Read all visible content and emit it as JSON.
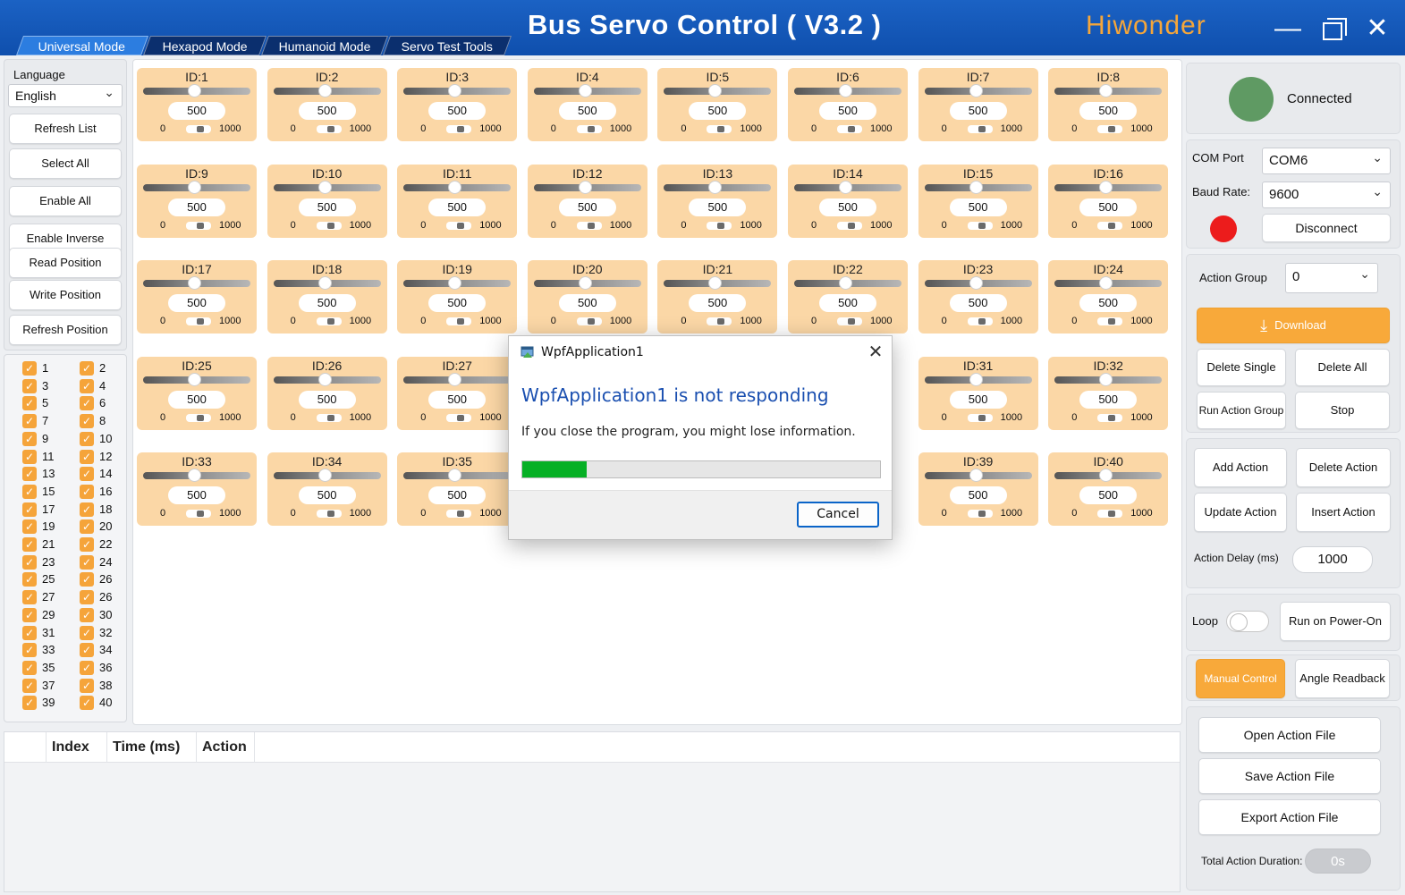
{
  "window": {
    "title": "Bus Servo Control ( V3.2 )",
    "brand": "Hiwonder",
    "minimize_glyph": "—",
    "close_glyph": "✕"
  },
  "tabs": [
    {
      "label": "Universal Mode",
      "active": true
    },
    {
      "label": "Hexapod Mode",
      "active": false
    },
    {
      "label": "Humanoid Mode",
      "active": false
    },
    {
      "label": "Servo Test Tools",
      "active": false
    }
  ],
  "left_panel": {
    "language_label": "Language",
    "language_value": "English",
    "buttons": {
      "refresh_list": "Refresh List",
      "select_all": "Select All",
      "enable_all": "Enable All",
      "enable_inverse": "Enable Inverse",
      "read_position": "Read Position",
      "write_position": "Write Position",
      "refresh_position": "Refresh Position"
    }
  },
  "checkboxes": [
    {
      "label": "1",
      "checked": true
    },
    {
      "label": "2",
      "checked": true
    },
    {
      "label": "3",
      "checked": true
    },
    {
      "label": "4",
      "checked": true
    },
    {
      "label": "5",
      "checked": true
    },
    {
      "label": "6",
      "checked": true
    },
    {
      "label": "7",
      "checked": true
    },
    {
      "label": "8",
      "checked": true
    },
    {
      "label": "9",
      "checked": true
    },
    {
      "label": "10",
      "checked": true
    },
    {
      "label": "11",
      "checked": true
    },
    {
      "label": "12",
      "checked": true
    },
    {
      "label": "13",
      "checked": true
    },
    {
      "label": "14",
      "checked": true
    },
    {
      "label": "15",
      "checked": true
    },
    {
      "label": "16",
      "checked": true
    },
    {
      "label": "17",
      "checked": true
    },
    {
      "label": "18",
      "checked": true
    },
    {
      "label": "19",
      "checked": true
    },
    {
      "label": "20",
      "checked": true
    },
    {
      "label": "21",
      "checked": true
    },
    {
      "label": "22",
      "checked": true
    },
    {
      "label": "23",
      "checked": true
    },
    {
      "label": "24",
      "checked": true
    },
    {
      "label": "25",
      "checked": true
    },
    {
      "label": "26",
      "checked": true
    },
    {
      "label": "27",
      "checked": true
    },
    {
      "label": "26",
      "checked": true
    },
    {
      "label": "29",
      "checked": true
    },
    {
      "label": "30",
      "checked": true
    },
    {
      "label": "31",
      "checked": true
    },
    {
      "label": "32",
      "checked": true
    },
    {
      "label": "33",
      "checked": true
    },
    {
      "label": "34",
      "checked": true
    },
    {
      "label": "35",
      "checked": true
    },
    {
      "label": "36",
      "checked": true
    },
    {
      "label": "37",
      "checked": true
    },
    {
      "label": "38",
      "checked": true
    },
    {
      "label": "39",
      "checked": true
    },
    {
      "label": "40",
      "checked": true
    }
  ],
  "servos": [
    {
      "id": "ID:1",
      "value": "500",
      "min": "0",
      "max": "1000"
    },
    {
      "id": "ID:2",
      "value": "500",
      "min": "0",
      "max": "1000"
    },
    {
      "id": "ID:3",
      "value": "500",
      "min": "0",
      "max": "1000"
    },
    {
      "id": "ID:4",
      "value": "500",
      "min": "0",
      "max": "1000"
    },
    {
      "id": "ID:5",
      "value": "500",
      "min": "0",
      "max": "1000"
    },
    {
      "id": "ID:6",
      "value": "500",
      "min": "0",
      "max": "1000"
    },
    {
      "id": "ID:7",
      "value": "500",
      "min": "0",
      "max": "1000"
    },
    {
      "id": "ID:8",
      "value": "500",
      "min": "0",
      "max": "1000"
    },
    {
      "id": "ID:9",
      "value": "500",
      "min": "0",
      "max": "1000"
    },
    {
      "id": "ID:10",
      "value": "500",
      "min": "0",
      "max": "1000"
    },
    {
      "id": "ID:11",
      "value": "500",
      "min": "0",
      "max": "1000"
    },
    {
      "id": "ID:12",
      "value": "500",
      "min": "0",
      "max": "1000"
    },
    {
      "id": "ID:13",
      "value": "500",
      "min": "0",
      "max": "1000"
    },
    {
      "id": "ID:14",
      "value": "500",
      "min": "0",
      "max": "1000"
    },
    {
      "id": "ID:15",
      "value": "500",
      "min": "0",
      "max": "1000"
    },
    {
      "id": "ID:16",
      "value": "500",
      "min": "0",
      "max": "1000"
    },
    {
      "id": "ID:17",
      "value": "500",
      "min": "0",
      "max": "1000"
    },
    {
      "id": "ID:18",
      "value": "500",
      "min": "0",
      "max": "1000"
    },
    {
      "id": "ID:19",
      "value": "500",
      "min": "0",
      "max": "1000"
    },
    {
      "id": "ID:20",
      "value": "500",
      "min": "0",
      "max": "1000"
    },
    {
      "id": "ID:21",
      "value": "500",
      "min": "0",
      "max": "1000"
    },
    {
      "id": "ID:22",
      "value": "500",
      "min": "0",
      "max": "1000"
    },
    {
      "id": "ID:23",
      "value": "500",
      "min": "0",
      "max": "1000"
    },
    {
      "id": "ID:24",
      "value": "500",
      "min": "0",
      "max": "1000"
    },
    {
      "id": "ID:25",
      "value": "500",
      "min": "0",
      "max": "1000"
    },
    {
      "id": "ID:26",
      "value": "500",
      "min": "0",
      "max": "1000"
    },
    {
      "id": "ID:27",
      "value": "500",
      "min": "0",
      "max": "1000"
    },
    {
      "id": "",
      "value": "",
      "min": "",
      "max": ""
    },
    {
      "id": "",
      "value": "",
      "min": "",
      "max": ""
    },
    {
      "id": "",
      "value": "",
      "min": "",
      "max": ""
    },
    {
      "id": "ID:31",
      "value": "500",
      "min": "0",
      "max": "1000"
    },
    {
      "id": "ID:32",
      "value": "500",
      "min": "0",
      "max": "1000"
    },
    {
      "id": "ID:33",
      "value": "500",
      "min": "0",
      "max": "1000"
    },
    {
      "id": "ID:34",
      "value": "500",
      "min": "0",
      "max": "1000"
    },
    {
      "id": "ID:35",
      "value": "500",
      "min": "0",
      "max": "1000"
    },
    {
      "id": "",
      "value": "",
      "min": "",
      "max": ""
    },
    {
      "id": "",
      "value": "",
      "min": "",
      "max": ""
    },
    {
      "id": "",
      "value": "",
      "min": "",
      "max": ""
    },
    {
      "id": "ID:39",
      "value": "500",
      "min": "0",
      "max": "1000"
    },
    {
      "id": "ID:40",
      "value": "500",
      "min": "0",
      "max": "1000"
    }
  ],
  "table": {
    "columns": [
      "Index",
      "Time (ms)",
      "Action"
    ]
  },
  "right_panel": {
    "status_text": "Connected",
    "status_color": "#5f9a63",
    "com_port_label": "COM Port",
    "com_port_value": "COM6",
    "baud_rate_label": "Baud Rate:",
    "baud_rate_value": "9600",
    "indicator_color": "#ec1c1c",
    "disconnect": "Disconnect",
    "action_group_label": "Action Group",
    "action_group_value": "0",
    "download": "Download",
    "delete_single": "Delete Single",
    "delete_all": "Delete All",
    "run_action_group": "Run Action Group",
    "stop": "Stop",
    "add_action": "Add Action",
    "delete_action": "Delete Action",
    "update_action": "Update Action",
    "insert_action": "Insert Action",
    "action_delay_label": "Action Delay (ms)",
    "action_delay_value": "1000",
    "loop_label": "Loop",
    "run_on_power_on": "Run on Power-On",
    "manual_control": "Manual Control",
    "angle_readback": "Angle Readback",
    "open_action_file": "Open Action File",
    "save_action_file": "Save Action File",
    "export_action_file": "Export Action File",
    "total_duration_label": "Total Action Duration:",
    "total_duration_value": "0s",
    "accent_color": "#f8a93a"
  },
  "dialog": {
    "title": "WpfApplication1",
    "heading": "WpfApplication1 is not responding",
    "message": "If you close the program, you might lose information.",
    "progress": 0.18,
    "cancel": "Cancel",
    "close_glyph": "✕"
  }
}
